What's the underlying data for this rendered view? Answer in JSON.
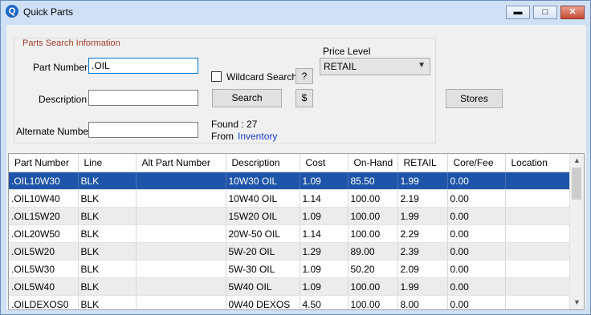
{
  "window": {
    "title": "Quick Parts",
    "app_icon": "Q",
    "minimize": "▬",
    "maximize": "□",
    "close": "✕"
  },
  "search": {
    "group_title": "Parts Search Information",
    "part_number_label": "Part Number :",
    "part_number_value": ".OIL",
    "description_label": "Description :",
    "description_value": "",
    "alternate_label": "Alternate Number :",
    "alternate_value": "",
    "wildcard_label": "Wildcard Search",
    "wildcard_checked": false,
    "help_button": "?",
    "search_button": "Search",
    "dollar_button": "$",
    "found_text": "Found : 27",
    "from_label": "From",
    "from_link": "Inventory",
    "price_level_label": "Price Level",
    "price_level_value": "RETAIL"
  },
  "stores_button": "Stores",
  "grid": {
    "columns": [
      "Part Number",
      "Line",
      "Alt Part Number",
      "Description",
      "Cost",
      "On-Hand",
      "RETAIL",
      "Core/Fee",
      "Location"
    ],
    "rows": [
      [
        ".OIL10W30",
        "BLK",
        "",
        "10W30 OIL",
        "1.09",
        "85.50",
        "1.99",
        "0.00",
        ""
      ],
      [
        ".OIL10W40",
        "BLK",
        "",
        "10W40 OIL",
        "1.14",
        "100.00",
        "2.19",
        "0.00",
        ""
      ],
      [
        ".OIL15W20",
        "BLK",
        "",
        "15W20 OIL",
        "1.09",
        "100.00",
        "1.99",
        "0.00",
        ""
      ],
      [
        ".OIL20W50",
        "BLK",
        "",
        "20W-50 OIL",
        "1.14",
        "100.00",
        "2.29",
        "0.00",
        ""
      ],
      [
        ".OIL5W20",
        "BLK",
        "",
        "5W-20 OIL",
        "1.29",
        "89.00",
        "2.39",
        "0.00",
        ""
      ],
      [
        ".OIL5W30",
        "BLK",
        "",
        "5W-30 OIL",
        "1.09",
        "50.20",
        "2.09",
        "0.00",
        ""
      ],
      [
        ".OIL5W40",
        "BLK",
        "",
        "5W40 OIL",
        "1.09",
        "100.00",
        "1.99",
        "0.00",
        ""
      ],
      [
        ".OILDEXOS0",
        "BLK",
        "",
        "0W40 DEXOS",
        "4.50",
        "100.00",
        "8.00",
        "0.00",
        ""
      ]
    ],
    "selected_row": 0
  },
  "colors": {
    "selection": "#1f55a8",
    "legend_text": "#a23b2a",
    "link": "#1a3cd1"
  }
}
